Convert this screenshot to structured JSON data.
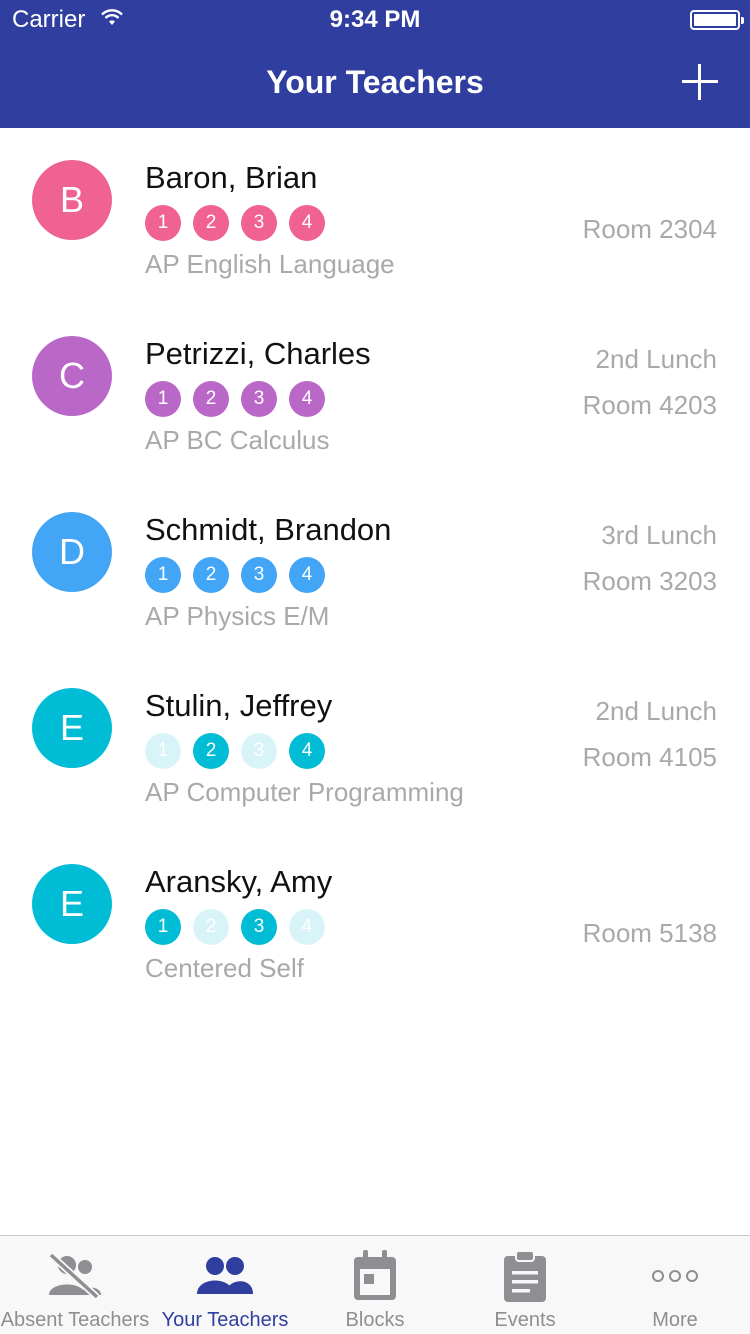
{
  "status": {
    "carrier": "Carrier",
    "time": "9:34 PM"
  },
  "navbar": {
    "title": "Your Teachers"
  },
  "teachers": [
    {
      "initial": "B",
      "name": "Baron, Brian",
      "course": "AP English Language",
      "lunch": "",
      "room": "Room 2304",
      "color": "#f06292",
      "blocks": [
        {
          "label": "1",
          "active": true
        },
        {
          "label": "2",
          "active": true
        },
        {
          "label": "3",
          "active": true
        },
        {
          "label": "4",
          "active": true
        }
      ]
    },
    {
      "initial": "C",
      "name": "Petrizzi, Charles",
      "course": "AP BC Calculus",
      "lunch": "2nd Lunch",
      "room": "Room 4203",
      "color": "#ba68c8",
      "blocks": [
        {
          "label": "1",
          "active": true
        },
        {
          "label": "2",
          "active": true
        },
        {
          "label": "3",
          "active": true
        },
        {
          "label": "4",
          "active": true
        }
      ]
    },
    {
      "initial": "D",
      "name": "Schmidt, Brandon",
      "course": "AP Physics E/M",
      "lunch": "3rd Lunch",
      "room": "Room 3203",
      "color": "#42a5f5",
      "blocks": [
        {
          "label": "1",
          "active": true
        },
        {
          "label": "2",
          "active": true
        },
        {
          "label": "3",
          "active": true
        },
        {
          "label": "4",
          "active": true
        }
      ]
    },
    {
      "initial": "E",
      "name": "Stulin, Jeffrey",
      "course": "AP Computer Programming",
      "lunch": "2nd Lunch",
      "room": "Room 4105",
      "color": "#00bcd4",
      "blocks": [
        {
          "label": "1",
          "active": false
        },
        {
          "label": "2",
          "active": true
        },
        {
          "label": "3",
          "active": false
        },
        {
          "label": "4",
          "active": true
        }
      ]
    },
    {
      "initial": "E",
      "name": "Aransky, Amy",
      "course": "Centered Self",
      "lunch": "",
      "room": "Room 5138",
      "color": "#00bcd4",
      "blocks": [
        {
          "label": "1",
          "active": true
        },
        {
          "label": "2",
          "active": false
        },
        {
          "label": "3",
          "active": true
        },
        {
          "label": "4",
          "active": false
        }
      ]
    }
  ],
  "tabbar": {
    "items": [
      {
        "label": "Absent Teachers",
        "icon": "absent-teachers-icon",
        "active": false
      },
      {
        "label": "Your Teachers",
        "icon": "your-teachers-icon",
        "active": true
      },
      {
        "label": "Blocks",
        "icon": "calendar-icon",
        "active": false
      },
      {
        "label": "Events",
        "icon": "clipboard-icon",
        "active": false
      },
      {
        "label": "More",
        "icon": "more-icon",
        "active": false
      }
    ]
  },
  "colors": {
    "primary": "#303f9f",
    "inactive_tab": "#8e8e93",
    "secondary_text": "#a9a9a9"
  }
}
